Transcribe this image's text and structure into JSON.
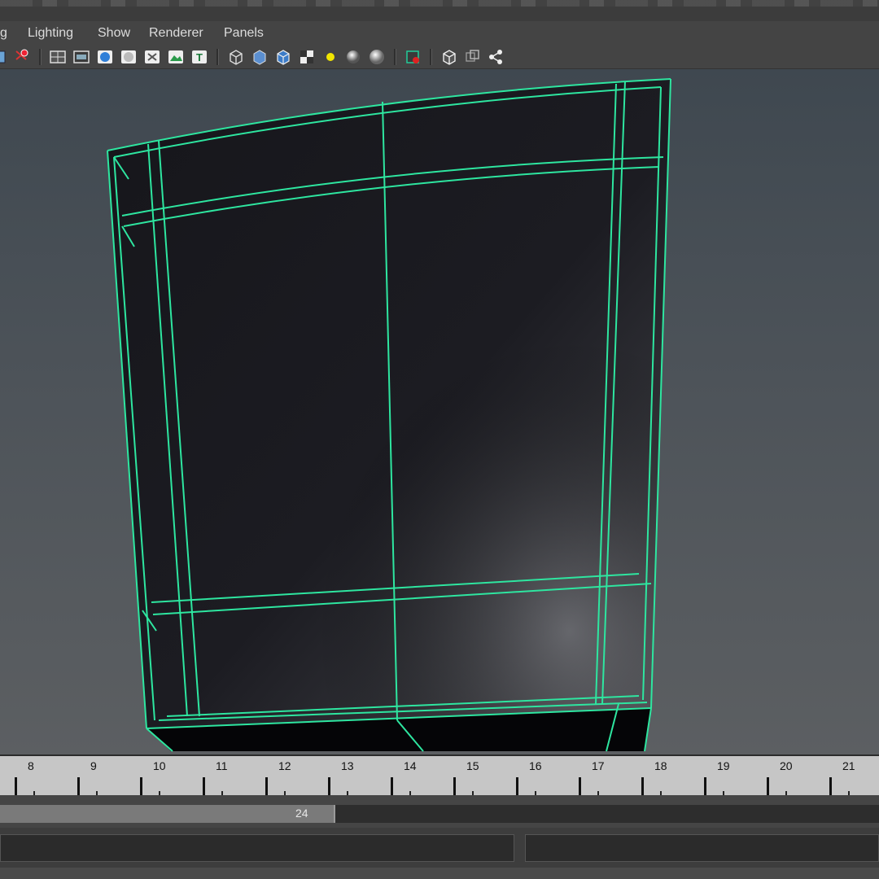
{
  "menu": {
    "items": [
      {
        "label": "g"
      },
      {
        "label": "Lighting"
      },
      {
        "label": "Show"
      },
      {
        "label": "Renderer"
      },
      {
        "label": "Panels"
      }
    ]
  },
  "toolbar": {
    "icons": [
      "move-tool-icon",
      "camera-attributes-icon",
      "grid-icon",
      "film-gate-icon",
      "shading-icon",
      "smooth-shade-icon",
      "xray-icon",
      "texture-icon",
      "text-icon",
      "wireframe-cube-icon",
      "shaded-cube-icon",
      "textured-cube-icon",
      "checker-icon",
      "default-light-icon",
      "sphere-icon",
      "sphere-smooth-icon",
      "isolate-select-icon",
      "wire-on-shaded-icon",
      "xray-joints-icon",
      "share-icon"
    ]
  },
  "viewport": {
    "wire_color": "#2ee6a0",
    "object": "bent-panel-mesh"
  },
  "timeline": {
    "frames": [
      "8",
      "9",
      "10",
      "11",
      "12",
      "13",
      "14",
      "15",
      "16",
      "17",
      "18",
      "19",
      "20",
      "21"
    ]
  },
  "range": {
    "end_frame": "24"
  },
  "colors": {
    "ui_bg": "#444444",
    "timeline_bg": "#c6c6c6",
    "accent": "#2ee6a0"
  }
}
